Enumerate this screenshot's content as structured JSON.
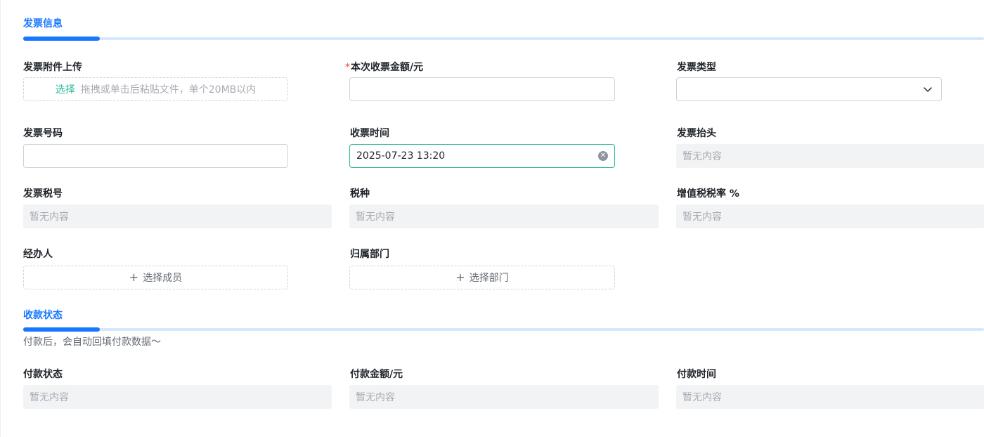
{
  "invoice_section": {
    "title": "发票信息",
    "fields": {
      "attachment": {
        "label": "发票附件上传",
        "choose": "选择",
        "hint": "拖拽或单击后粘贴文件，单个20MB以内"
      },
      "amount": {
        "required_mark": "*",
        "label": "本次收票金额/元",
        "value": ""
      },
      "type": {
        "label": "发票类型",
        "value": ""
      },
      "number": {
        "label": "发票号码",
        "value": ""
      },
      "receive_time": {
        "label": "收票时间",
        "value": "2025-07-23 13:20"
      },
      "header": {
        "label": "发票抬头",
        "value": "暂无内容"
      },
      "tax_id": {
        "label": "发票税号",
        "value": "暂无内容"
      },
      "tax_category": {
        "label": "税种",
        "value": "暂无内容"
      },
      "vat_rate": {
        "label": "增值税税率 %",
        "value": "暂无内容"
      },
      "handler": {
        "label": "经办人",
        "button": "选择成员"
      },
      "department": {
        "label": "归属部门",
        "button": "选择部门"
      }
    }
  },
  "payment_section": {
    "title": "收款状态",
    "hint": "付款后，会自动回填付款数据～",
    "fields": {
      "status": {
        "label": "付款状态",
        "value": "暂无内容"
      },
      "amount": {
        "label": "付款金额/元",
        "value": "暂无内容"
      },
      "time": {
        "label": "付款时间",
        "value": "暂无内容"
      }
    }
  },
  "colors": {
    "accent": "#1677ff",
    "focus": "#2bb89a",
    "required": "#f54a45"
  },
  "icons": [
    "chevron-down-icon",
    "clear-icon",
    "plus-icon"
  ]
}
